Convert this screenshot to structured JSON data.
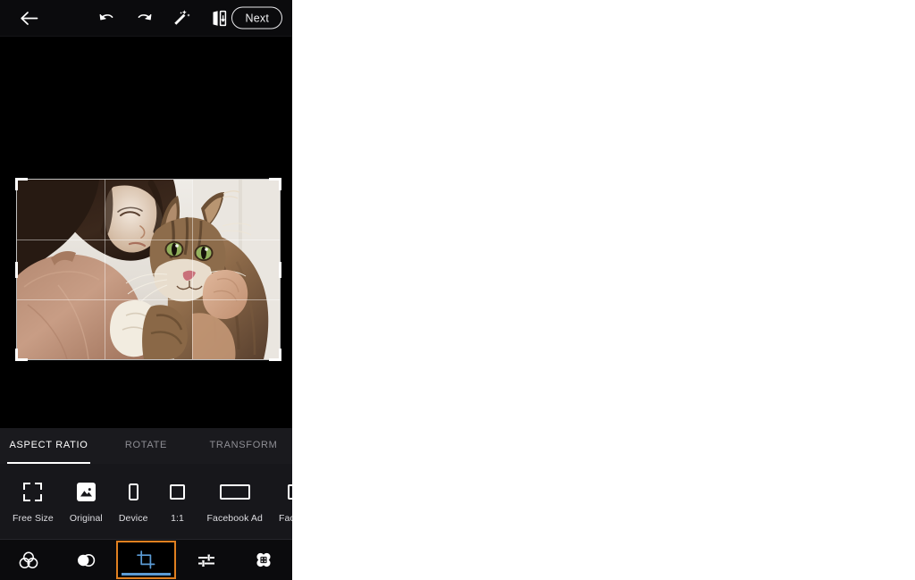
{
  "app": {
    "background_color": "#000000",
    "accent_selected_border": "#e08020",
    "accent_active_icon": "#5b9bd5"
  },
  "topbar": {
    "back_icon": "arrow-left-icon",
    "undo_icon": "undo-icon",
    "redo_icon": "redo-icon",
    "magic_icon": "magic-wand-icon",
    "compare_icon": "before-after-compare-icon",
    "next_label": "Next"
  },
  "canvas": {
    "crop_overlay": "rule-of-thirds-grid",
    "photo_description": "woman-hugging-tabby-cat"
  },
  "mode_tabs": [
    {
      "label": "ASPECT RATIO",
      "active": true
    },
    {
      "label": "ROTATE",
      "active": false
    },
    {
      "label": "TRANSFORM",
      "active": false
    }
  ],
  "aspect_ratios": [
    {
      "label": "Free Size",
      "icon": "free-size-icon"
    },
    {
      "label": "Original",
      "icon": "original-image-icon"
    },
    {
      "label": "Device",
      "icon": "device-portrait-icon"
    },
    {
      "label": "1:1",
      "icon": "square-ratio-icon"
    },
    {
      "label": "Facebook Ad",
      "icon": "landscape-ratio-icon"
    },
    {
      "label": "Facebook",
      "icon": "landscape-ratio-icon"
    }
  ],
  "bottom_nav": [
    {
      "name": "effects",
      "icon": "three-overlapping-circles-icon",
      "selected": false
    },
    {
      "name": "filters",
      "icon": "half-filled-circles-icon",
      "selected": false
    },
    {
      "name": "crop",
      "icon": "crop-icon",
      "selected": true
    },
    {
      "name": "adjust",
      "icon": "sliders-icon",
      "selected": false
    },
    {
      "name": "heal",
      "icon": "bandage-heal-icon",
      "selected": false
    }
  ]
}
